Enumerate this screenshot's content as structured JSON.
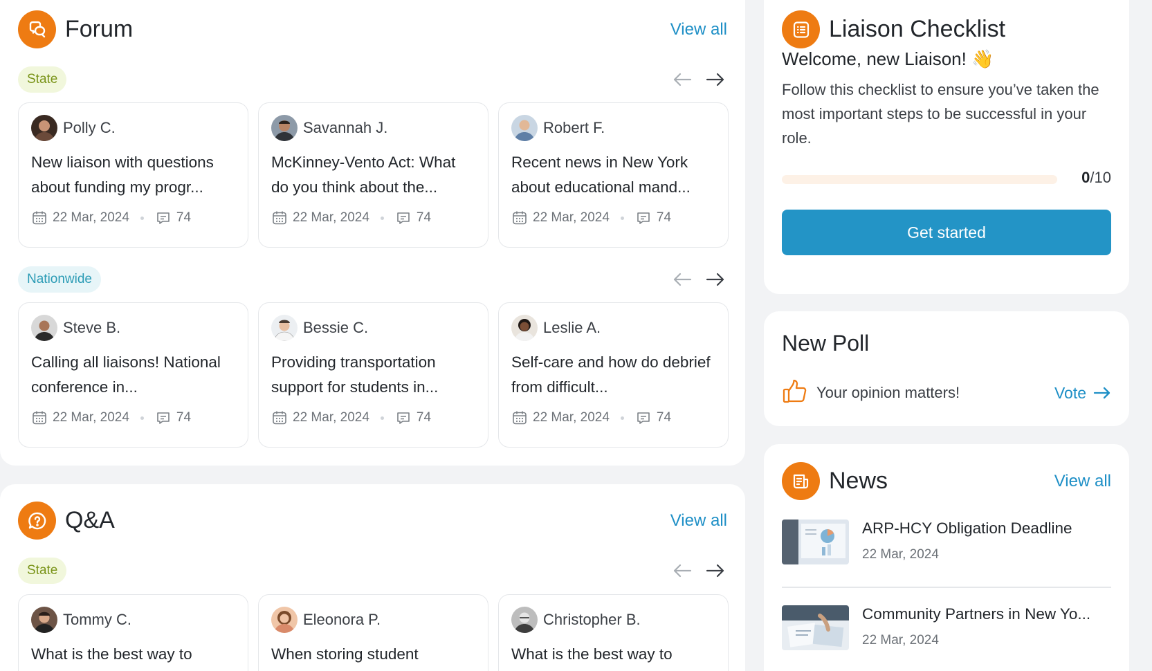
{
  "forum": {
    "title": "Forum",
    "view_all": "View all",
    "groups": [
      {
        "tag": "State",
        "posts": [
          {
            "author": "Polly C.",
            "title": "New liaison with questions about funding my progr...",
            "date": "22 Mar, 2024",
            "comments": "74"
          },
          {
            "author": "Savannah J.",
            "title": "McKinney-Vento Act: What do you think about the...",
            "date": "22 Mar, 2024",
            "comments": "74"
          },
          {
            "author": "Robert F.",
            "title": "Recent news in New York about educational mand...",
            "date": "22 Mar, 2024",
            "comments": "74"
          }
        ]
      },
      {
        "tag": "Nationwide",
        "posts": [
          {
            "author": "Steve B.",
            "title": "Calling all liaisons! National conference in...",
            "date": "22 Mar, 2024",
            "comments": "74"
          },
          {
            "author": "Bessie C.",
            "title": "Providing transportation support for students in...",
            "date": "22 Mar, 2024",
            "comments": "74"
          },
          {
            "author": "Leslie A.",
            "title": "Self-care and how do debrief from difficult...",
            "date": "22 Mar, 2024",
            "comments": "74"
          }
        ]
      }
    ]
  },
  "qa": {
    "title": "Q&A",
    "view_all": "View all",
    "tag": "State",
    "posts": [
      {
        "author": "Tommy C.",
        "title": "What is the best way to"
      },
      {
        "author": "Eleonora P.",
        "title": "When storing student"
      },
      {
        "author": "Christopher B.",
        "title": "What is the best way to"
      }
    ]
  },
  "checklist": {
    "title": "Liaison Checklist",
    "welcome": "Welcome, new Liaison! 👋",
    "description": "Follow this checklist to ensure you’ve taken the most important steps to be successful in your role.",
    "progress_done": "0",
    "progress_total": "/10",
    "progress_fraction": 0,
    "button": "Get started"
  },
  "poll": {
    "title": "New Poll",
    "text": "Your opinion matters!",
    "vote": "Vote"
  },
  "news": {
    "title": "News",
    "view_all": "View all",
    "items": [
      {
        "title": "ARP-HCY Obligation Deadline",
        "date": "22 Mar, 2024"
      },
      {
        "title": "Community Partners in New Yo...",
        "date": "22 Mar, 2024"
      }
    ]
  },
  "colors": {
    "accent": "#ee7b12",
    "link": "#1e8fc6",
    "primary_button": "#2394c6"
  }
}
